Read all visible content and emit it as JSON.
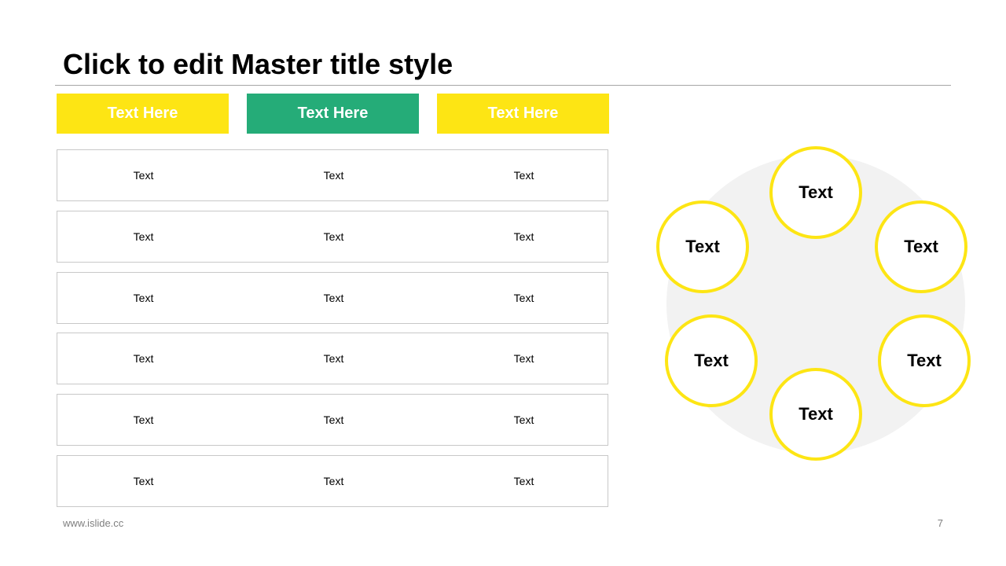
{
  "title": "Click to edit Master title style",
  "colors": {
    "yellow": "#fde514",
    "green": "#25ac78",
    "circle_bg": "#f2f2f2",
    "rule": "#a6a6a6"
  },
  "headers": [
    {
      "label": "Text Here",
      "color": "yellow"
    },
    {
      "label": "Text Here",
      "color": "green"
    },
    {
      "label": "Text Here",
      "color": "yellow"
    }
  ],
  "table": {
    "rows": [
      [
        "Text",
        "Text",
        "Text"
      ],
      [
        "Text",
        "Text",
        "Text"
      ],
      [
        "Text",
        "Text",
        "Text"
      ],
      [
        "Text",
        "Text",
        "Text"
      ],
      [
        "Text",
        "Text",
        "Text"
      ],
      [
        "Text",
        "Text",
        "Text"
      ]
    ]
  },
  "cycle": {
    "nodes": [
      "Text",
      "Text",
      "Text",
      "Text",
      "Text",
      "Text"
    ]
  },
  "footer": {
    "url": "www.islide.cc",
    "page": "7"
  }
}
